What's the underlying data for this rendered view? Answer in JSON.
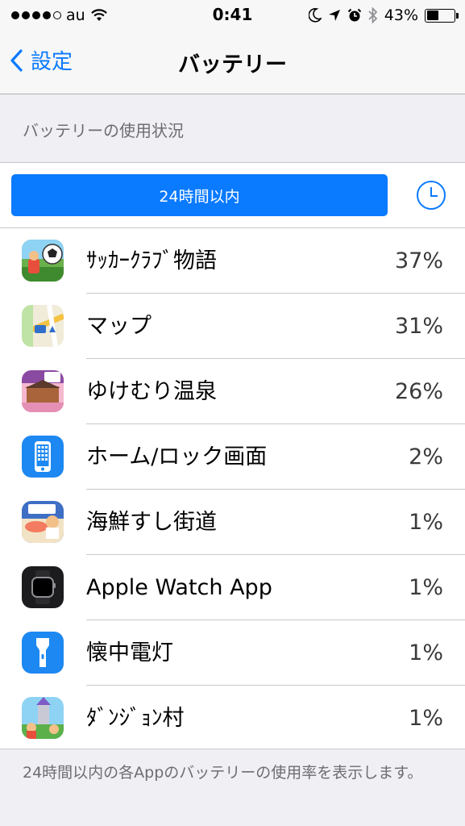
{
  "status_bar": {
    "carrier": "au",
    "time": "0:41",
    "battery_percent": "43%",
    "battery_level": 0.43,
    "icons": [
      "signal-dots-icon",
      "wifi-icon",
      "moon-icon",
      "location-arrow-icon",
      "alarm-icon",
      "bluetooth-icon",
      "battery-icon"
    ]
  },
  "nav": {
    "back_label": "設定",
    "title": "バッテリー"
  },
  "section_header": "バッテリーの使用状況",
  "segment": {
    "selected_label": "24時間以内",
    "clock_icon": "clock-icon"
  },
  "apps": [
    {
      "name": "ｻｯｶｰｸﾗﾌﾞ物語",
      "percent": "37%",
      "icon": "soccer-club-app-icon"
    },
    {
      "name": "マップ",
      "percent": "31%",
      "icon": "maps-app-icon"
    },
    {
      "name": "ゆけむり温泉",
      "percent": "26%",
      "icon": "onsen-app-icon"
    },
    {
      "name": "ホーム/ロック画面",
      "percent": "2%",
      "icon": "home-lock-screen-icon"
    },
    {
      "name": "海鮮すし街道",
      "percent": "1%",
      "icon": "sushi-app-icon"
    },
    {
      "name": "Apple Watch App",
      "percent": "1%",
      "icon": "apple-watch-app-icon"
    },
    {
      "name": "懐中電灯",
      "percent": "1%",
      "icon": "flashlight-icon"
    },
    {
      "name": "ﾀﾞﾝｼﾞｮﾝ村",
      "percent": "1%",
      "icon": "dungeon-village-app-icon"
    }
  ],
  "footer_text": "24時間以内の各Appのバッテリーの使用率を表示します。",
  "colors": {
    "accent": "#0a7aff",
    "background": "#efeff4",
    "secondary_text": "#6d6d72"
  }
}
